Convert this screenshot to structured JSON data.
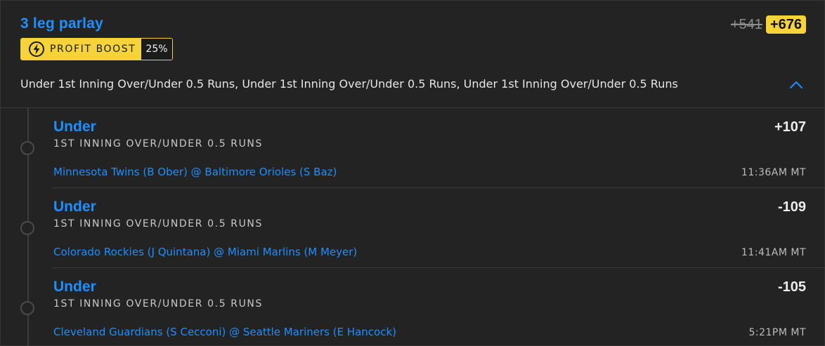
{
  "header": {
    "title": "3 leg parlay",
    "original_odds": "+541",
    "boosted_odds": "+676",
    "summary": "Under 1st Inning Over/Under 0.5 Runs, Under 1st Inning Over/Under 0.5 Runs, Under 1st Inning Over/Under 0.5 Runs"
  },
  "boost": {
    "label": "PROFIT BOOST",
    "percent": "25%",
    "icon": "lightning-boost-icon"
  },
  "colors": {
    "accent": "#1e8fff",
    "boost": "#f6d339",
    "background": "#232323"
  },
  "legs": [
    {
      "selection": "Under",
      "market": "1ST INNING OVER/UNDER 0.5 RUNS",
      "game": "Minnesota Twins (B Ober) @ Baltimore Orioles (S Baz)",
      "odds": "+107",
      "time": "11:36AM MT"
    },
    {
      "selection": "Under",
      "market": "1ST INNING OVER/UNDER 0.5 RUNS",
      "game": "Colorado Rockies (J Quintana) @ Miami Marlins (M Meyer)",
      "odds": "-109",
      "time": "11:41AM MT"
    },
    {
      "selection": "Under",
      "market": "1ST INNING OVER/UNDER 0.5 RUNS",
      "game": "Cleveland Guardians (S Cecconi) @ Seattle Mariners (E Hancock)",
      "odds": "-105",
      "time": "5:21PM MT"
    }
  ]
}
